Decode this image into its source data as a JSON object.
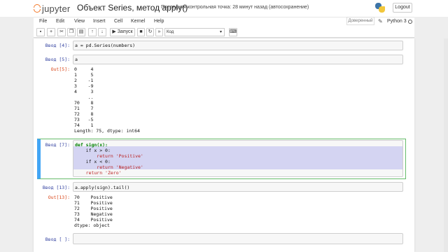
{
  "header": {
    "logo_text": "jupyter",
    "notebook_title": "Объект Series, метод apply()",
    "checkpoint": "Последняя контрольная точка: 28 минут назад  (автосохранение)",
    "logout_label": "Logout"
  },
  "menu": {
    "items": [
      "File",
      "Edit",
      "View",
      "Insert",
      "Cell",
      "Kernel",
      "Help"
    ],
    "trusted_label": "Доверенный",
    "kernel_name": "Python 3"
  },
  "toolbar": {
    "run_label": "Запуск",
    "cell_type": "Код",
    "icons": [
      "save-icon",
      "add-cell-icon",
      "cut-icon",
      "copy-icon",
      "paste-icon",
      "move-up-icon",
      "move-down-icon",
      "run-icon",
      "stop-icon",
      "restart-icon",
      "restart-run-icon",
      "keyboard-icon"
    ]
  },
  "cells": [
    {
      "prompt": "Ввод [4]:",
      "code": "a = pd.Series(numbers)"
    },
    {
      "prompt": "Ввод [5]:",
      "code": "a",
      "out_prompt": "Out[5]:",
      "output": "0     4\n1     5\n2    -1\n3    -9\n4     3\n     ..\n70    8\n71    7\n72    8\n73   -5\n74    1\nLength: 75, dtype: int64"
    },
    {
      "prompt": "Ввод [7]:",
      "code_lines": [
        "def sign(x):",
        "    if x > 0:",
        "        return 'Positive'",
        "    if x < 0:",
        "        return 'Negative'",
        "    return 'Zero'"
      ]
    },
    {
      "prompt": "Ввод [13]:",
      "code": "a.apply(sign).tail()",
      "out_prompt": "Out[13]:",
      "output": "70    Positive\n71    Positive\n72    Positive\n73    Negative\n74    Positive\ndtype: object"
    },
    {
      "prompt": "Ввод [ ]:",
      "code": ""
    }
  ]
}
